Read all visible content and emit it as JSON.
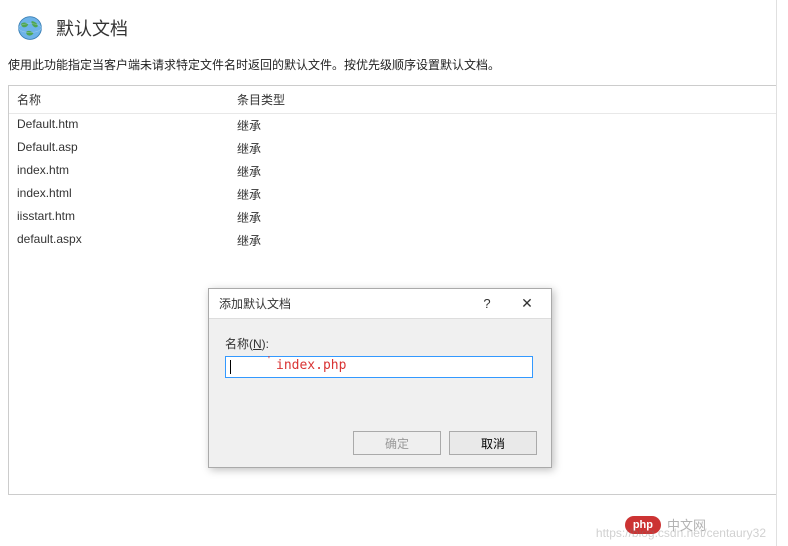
{
  "page": {
    "title": "默认文档",
    "description": "使用此功能指定当客户端未请求特定文件名时返回的默认文件。按优先级顺序设置默认文档。"
  },
  "columns": {
    "name": "名称",
    "type": "条目类型"
  },
  "rows": [
    {
      "name": "Default.htm",
      "type": "继承"
    },
    {
      "name": "Default.asp",
      "type": "继承"
    },
    {
      "name": "index.htm",
      "type": "继承"
    },
    {
      "name": "index.html",
      "type": "继承"
    },
    {
      "name": "iisstart.htm",
      "type": "继承"
    },
    {
      "name": "default.aspx",
      "type": "继承"
    }
  ],
  "dialog": {
    "title": "添加默认文档",
    "help_symbol": "?",
    "close_symbol": "✕",
    "field_label_prefix": "名称(",
    "field_label_key": "N",
    "field_label_suffix": "):",
    "input_value": "",
    "input_hint": "index.php",
    "ok_label": "确定",
    "cancel_label": "取消"
  },
  "watermark": {
    "url": "https://blog.csdn.net/centaury32",
    "badge": "php",
    "site": "中文网"
  }
}
